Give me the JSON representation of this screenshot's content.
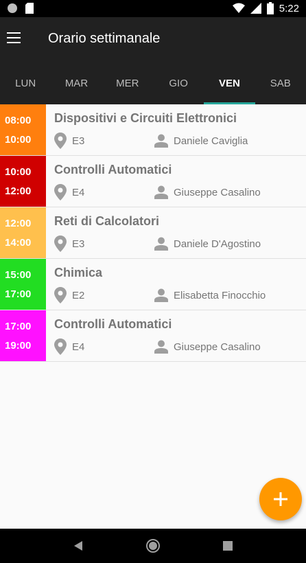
{
  "status_bar": {
    "time": "5:22"
  },
  "app_bar": {
    "title": "Orario settimanale"
  },
  "tabs": [
    {
      "label": "LUN"
    },
    {
      "label": "MAR"
    },
    {
      "label": "MER"
    },
    {
      "label": "GIO"
    },
    {
      "label": "VEN",
      "active": true
    },
    {
      "label": "SAB"
    }
  ],
  "lessons": [
    {
      "start": "08:00",
      "end": "10:00",
      "course": "Dispositivi e Circuiti Elettronici",
      "room": "E3",
      "teacher": "Daniele Caviglia",
      "color": "#ff7f0e"
    },
    {
      "start": "10:00",
      "end": "12:00",
      "course": "Controlli Automatici",
      "room": "E4",
      "teacher": "Giuseppe Casalino",
      "color": "#d00000"
    },
    {
      "start": "12:00",
      "end": "14:00",
      "course": "Reti di Calcolatori",
      "room": "E3",
      "teacher": "Daniele D'Agostino",
      "color": "#ffc04d"
    },
    {
      "start": "15:00",
      "end": "17:00",
      "course": "Chimica",
      "room": "E2",
      "teacher": "Elisabetta Finocchio",
      "color": "#22dd22"
    },
    {
      "start": "17:00",
      "end": "19:00",
      "course": "Controlli Automatici",
      "room": "E4",
      "teacher": "Giuseppe Casalino",
      "color": "#ff11ff"
    }
  ],
  "colors": {
    "app_bar": "#212121",
    "tab_indicator": "#26a69a",
    "fab": "#ff9800"
  },
  "icons": {
    "menu": "menu-icon",
    "location": "location-pin-icon",
    "person": "person-icon",
    "add": "add-icon"
  }
}
